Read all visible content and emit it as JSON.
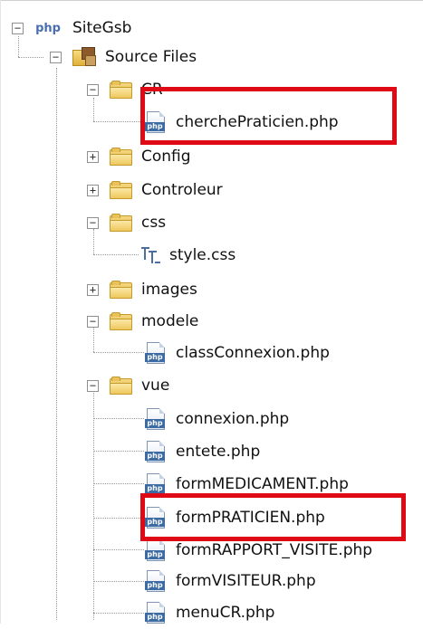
{
  "project": {
    "icon": "php-project-icon",
    "name": "SiteGsb",
    "source_files": {
      "label": "Source Files",
      "folders": [
        {
          "name": "CR",
          "expanded": true,
          "files": [
            {
              "name": "cherchePraticien.php",
              "type": "php",
              "highlighted": true
            }
          ]
        },
        {
          "name": "Config",
          "expanded": false
        },
        {
          "name": "Controleur",
          "expanded": false
        },
        {
          "name": "css",
          "expanded": true,
          "files": [
            {
              "name": "style.css",
              "type": "css"
            }
          ]
        },
        {
          "name": "images",
          "expanded": false
        },
        {
          "name": "modele",
          "expanded": true,
          "files": [
            {
              "name": "classConnexion.php",
              "type": "php"
            }
          ]
        },
        {
          "name": "vue",
          "expanded": true,
          "files": [
            {
              "name": "connexion.php",
              "type": "php"
            },
            {
              "name": "entete.php",
              "type": "php"
            },
            {
              "name": "formMEDICAMENT.php",
              "type": "php"
            },
            {
              "name": "formPRATICIEN.php",
              "type": "php",
              "highlighted": true
            },
            {
              "name": "formRAPPORT_VISITE.php",
              "type": "php"
            },
            {
              "name": "formVISITEUR.php",
              "type": "php"
            },
            {
              "name": "menuCR.php",
              "type": "php"
            }
          ]
        }
      ]
    }
  },
  "toggles": {
    "expanded": "−",
    "collapsed": "+"
  },
  "colors": {
    "highlight": "#e00a16",
    "folder": "#e9c35a",
    "php_badge": "#3c6ba4"
  }
}
